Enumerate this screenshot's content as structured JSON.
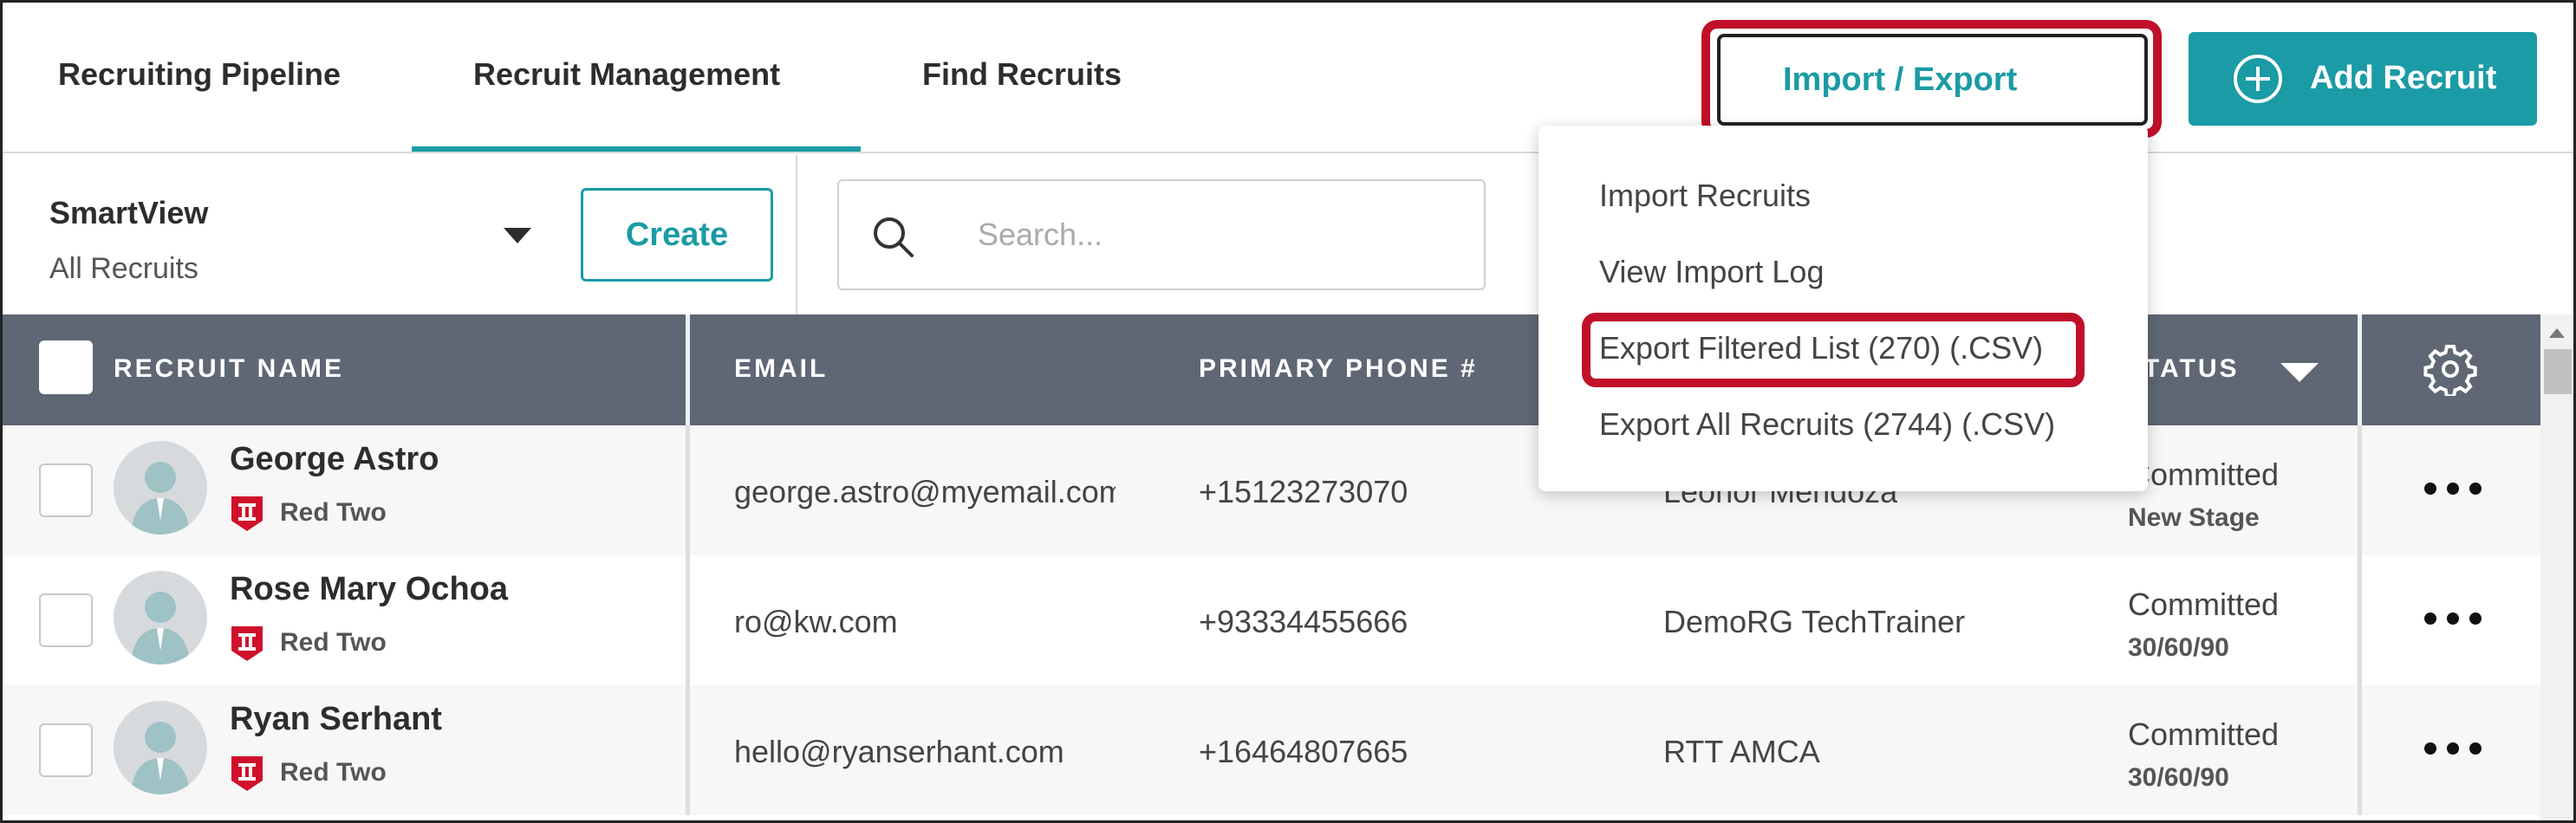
{
  "tabs": [
    {
      "label": "Recruiting Pipeline"
    },
    {
      "label": "Recruit Management",
      "active": true
    },
    {
      "label": "Find Recruits"
    }
  ],
  "toolbar": {
    "import_export_label": "Import / Export",
    "add_recruit_label": "Add Recruit"
  },
  "filter": {
    "smartview_label": "SmartView",
    "smartview_value": "All Recruits",
    "create_label": "Create",
    "search_placeholder": "Search..."
  },
  "menu": {
    "items": [
      {
        "label": "Import Recruits"
      },
      {
        "label": "View Import Log"
      },
      {
        "label": "Export Filtered List (270) (.CSV)",
        "highlighted": true
      },
      {
        "label": "Export All Recruits (2744) (.CSV)"
      }
    ]
  },
  "table": {
    "columns": {
      "name": "RECRUIT NAME",
      "email": "EMAIL",
      "phone": "PRIMARY PHONE #",
      "status": "TATUS"
    },
    "rows": [
      {
        "name": "George Astro",
        "team": "Red Two",
        "email": "george.astro@myemail.com",
        "phone": "+15123273070",
        "agent": "Leonor Mendoza",
        "status": "Committed",
        "stage": "New Stage"
      },
      {
        "name": "Rose Mary Ochoa",
        "team": "Red Two",
        "email": "ro@kw.com",
        "phone": "+93334455666",
        "agent": "DemoRG TechTrainer",
        "status": "Committed",
        "stage": "30/60/90"
      },
      {
        "name": "Ryan Serhant",
        "team": "Red Two",
        "email": "hello@ryanserhant.com",
        "phone": "+16464807665",
        "agent": "RTT AMCA",
        "status": "Committed",
        "stage": "30/60/90"
      }
    ]
  },
  "colors": {
    "accent": "#1a9ba5",
    "header_bg": "#5f6775",
    "highlight": "#c0102a",
    "team_badge": "#d0112b"
  },
  "icons": {
    "add": "plus-circle-icon",
    "search": "search-icon",
    "settings": "gear-icon",
    "team": "team-badge-icon",
    "row_menu": "more-horizontal-icon"
  }
}
